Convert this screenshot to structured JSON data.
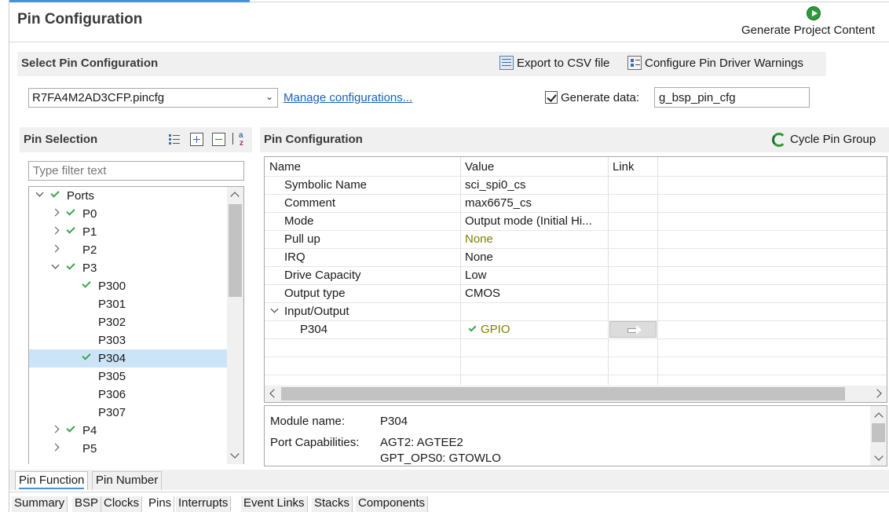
{
  "page": {
    "title": "Pin Configuration",
    "generate_button": "Generate Project Content"
  },
  "select_section": {
    "title": "Select Pin Configuration",
    "export_label": "Export to CSV file",
    "warnings_label": "Configure Pin Driver Warnings",
    "config_selected": "R7FA4M2AD3CFP.pincfg",
    "manage_link": "Manage configurations...",
    "generate_data_checked": true,
    "generate_data_label": "Generate data:",
    "generate_data_value": "g_bsp_pin_cfg"
  },
  "pin_selection": {
    "title": "Pin Selection",
    "toolbar": [
      "list-icon",
      "expand-all-icon",
      "collapse-all-icon",
      "sort-az-icon"
    ],
    "filter_placeholder": "Type filter text",
    "tree": [
      {
        "label": "Ports",
        "depth": 0,
        "toggle": "expanded",
        "checked": true,
        "selected": false
      },
      {
        "label": "P0",
        "depth": 1,
        "toggle": "collapsed",
        "checked": true,
        "selected": false
      },
      {
        "label": "P1",
        "depth": 1,
        "toggle": "collapsed",
        "checked": true,
        "selected": false
      },
      {
        "label": "P2",
        "depth": 1,
        "toggle": "collapsed",
        "checked": false,
        "selected": false
      },
      {
        "label": "P3",
        "depth": 1,
        "toggle": "expanded",
        "checked": true,
        "selected": false
      },
      {
        "label": "P300",
        "depth": 2,
        "toggle": "none",
        "checked": true,
        "selected": false
      },
      {
        "label": "P301",
        "depth": 2,
        "toggle": "none",
        "checked": false,
        "selected": false
      },
      {
        "label": "P302",
        "depth": 2,
        "toggle": "none",
        "checked": false,
        "selected": false
      },
      {
        "label": "P303",
        "depth": 2,
        "toggle": "none",
        "checked": false,
        "selected": false
      },
      {
        "label": "P304",
        "depth": 2,
        "toggle": "none",
        "checked": true,
        "selected": true
      },
      {
        "label": "P305",
        "depth": 2,
        "toggle": "none",
        "checked": false,
        "selected": false
      },
      {
        "label": "P306",
        "depth": 2,
        "toggle": "none",
        "checked": false,
        "selected": false
      },
      {
        "label": "P307",
        "depth": 2,
        "toggle": "none",
        "checked": false,
        "selected": false
      },
      {
        "label": "P4",
        "depth": 1,
        "toggle": "collapsed",
        "checked": true,
        "selected": false
      },
      {
        "label": "P5",
        "depth": 1,
        "toggle": "collapsed",
        "checked": false,
        "selected": false
      }
    ]
  },
  "pin_config": {
    "title": "Pin Configuration",
    "cycle_label": "Cycle Pin Group",
    "columns": [
      "Name",
      "Value",
      "Link"
    ],
    "rows": [
      {
        "name": "Symbolic Name",
        "value": "sci_spi0_cs",
        "style": "normal",
        "indent": 1
      },
      {
        "name": "Comment",
        "value": "max6675_cs",
        "style": "normal",
        "indent": 1
      },
      {
        "name": "Mode",
        "value": "Output mode (Initial Hi...",
        "style": "normal",
        "indent": 1
      },
      {
        "name": "Pull up",
        "value": "None",
        "style": "gold",
        "indent": 1
      },
      {
        "name": "IRQ",
        "value": "None",
        "style": "normal",
        "indent": 1
      },
      {
        "name": "Drive Capacity",
        "value": "Low",
        "style": "normal",
        "indent": 1
      },
      {
        "name": "Output type",
        "value": "CMOS",
        "style": "normal",
        "indent": 1
      },
      {
        "name": "Input/Output",
        "value": "",
        "style": "group",
        "indent": 1
      },
      {
        "name": "P304",
        "value": "GPIO",
        "style": "gpio",
        "indent": 2
      }
    ]
  },
  "details": {
    "module_label": "Module name:",
    "module_value": "P304",
    "capabilities_label": "Port Capabilities:",
    "capabilities": [
      "AGT2: AGTEE2",
      "GPT_OPS0: GTOWLO"
    ]
  },
  "sub_tabs": [
    {
      "label": "Pin Function",
      "active": true
    },
    {
      "label": "Pin Number",
      "active": false
    }
  ],
  "editor_tabs": [
    {
      "label": "Summary",
      "active": false
    },
    {
      "label": "BSP",
      "active": false
    },
    {
      "label": "Clocks",
      "active": false
    },
    {
      "label": "Pins",
      "active": true
    },
    {
      "label": "Interrupts",
      "active": false
    },
    {
      "label": "Event Links",
      "active": false
    },
    {
      "label": "Stacks",
      "active": false
    },
    {
      "label": "Components",
      "active": false
    }
  ]
}
